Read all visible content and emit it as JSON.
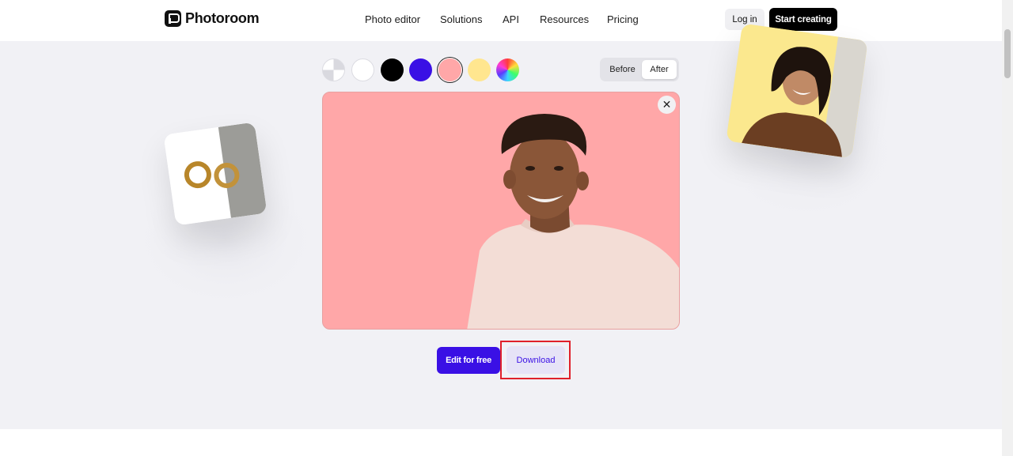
{
  "brand": {
    "name": "Photoroom"
  },
  "nav": {
    "links": [
      "Photo editor",
      "Solutions",
      "API",
      "Resources",
      "Pricing"
    ],
    "login_label": "Log in",
    "start_label": "Start creating"
  },
  "editor": {
    "background_swatches": [
      {
        "name": "transparent",
        "color": "#ffffff"
      },
      {
        "name": "white",
        "color": "#ffffff"
      },
      {
        "name": "black",
        "color": "#000000"
      },
      {
        "name": "purple",
        "color": "#3a10e5"
      },
      {
        "name": "pink",
        "color": "#ffa7a8",
        "selected": true
      },
      {
        "name": "yellow",
        "color": "#ffe68f"
      },
      {
        "name": "rainbow",
        "color": "multicolor"
      }
    ],
    "toggle": {
      "before_label": "Before",
      "after_label": "After",
      "selected": "After"
    },
    "close_icon": "close-icon",
    "edit_label": "Edit for free",
    "download_label": "Download"
  },
  "colors": {
    "accent": "#3a10e5",
    "preview_background": "#ffa7a8",
    "hero_background": "#f1f1f5",
    "highlight": "#e0202a"
  }
}
